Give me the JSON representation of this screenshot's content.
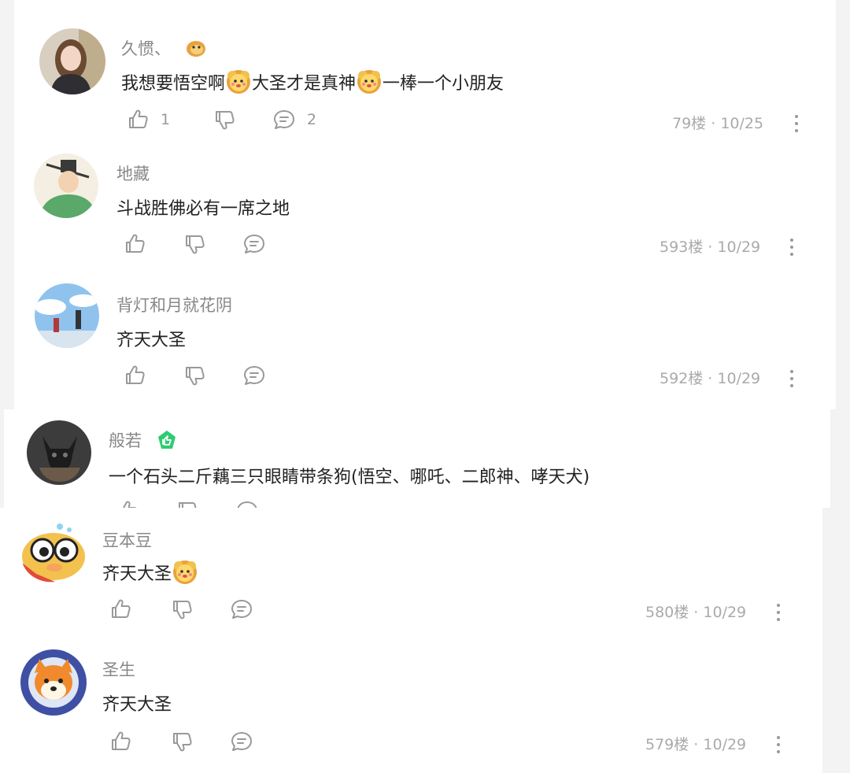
{
  "colors": {
    "text": "#222222",
    "muted": "#888888",
    "icon": "#999999",
    "badge_green": "#2ecc71"
  },
  "comments": [
    {
      "user": "久惯、",
      "badge_icon": "doge-emoji-icon",
      "text_parts": [
        "我想要悟空啊",
        "大圣才是真神",
        "一棒一个小朋友"
      ],
      "inline_emoji": "flower-face-emoji-icon",
      "likes": "1",
      "replies": "2",
      "floor": "79楼",
      "date": "10/25"
    },
    {
      "user": "地藏",
      "text": "斗战胜佛必有一席之地",
      "floor": "593楼",
      "date": "10/29"
    },
    {
      "user": "背灯和月就花阴",
      "text": "齐天大圣",
      "floor": "592楼",
      "date": "10/29"
    },
    {
      "user": "般若",
      "badge_icon": "green-thumb-badge-icon",
      "text": "一个石头二斤藕三只眼睛带条狗(悟空、哪吒、二郎神、哮天犬)"
    },
    {
      "user": "豆本豆",
      "text": "齐天大圣",
      "inline_emoji": "flower-face-emoji-icon",
      "floor": "580楼",
      "date": "10/29"
    },
    {
      "user": "圣生",
      "text": "齐天大圣",
      "floor": "579楼",
      "date": "10/29"
    }
  ],
  "separator": " · "
}
